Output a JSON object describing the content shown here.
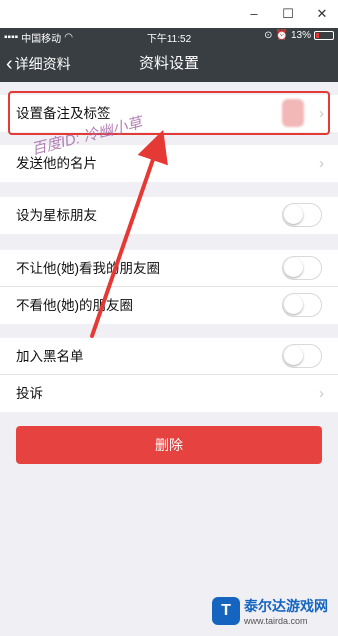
{
  "status_bar": {
    "carrier": "中国移动",
    "time": "下午11:52",
    "battery": "13%"
  },
  "window_controls": {
    "minimize": "–",
    "maximize": "☐",
    "close": "✕"
  },
  "nav": {
    "back_label": "详细资料",
    "title": "资料设置"
  },
  "settings": {
    "remark_label": "设置备注及标签",
    "send_card_label": "发送他的名片",
    "star_label": "设为星标朋友",
    "hide_from_label": "不让他(她)看我的朋友圈",
    "dont_view_label": "不看他(她)的朋友圈",
    "blacklist_label": "加入黑名单",
    "report_label": "投诉"
  },
  "toggles": {
    "star": false,
    "hide_from": false,
    "dont_view": false,
    "blacklist": false
  },
  "actions": {
    "delete_label": "删除"
  },
  "watermark": {
    "text": "百度ID: 冷幽小草"
  },
  "logo": {
    "name": "泰尔达游戏网",
    "url": "www.tairda.com"
  },
  "colors": {
    "nav_bg": "#383e42",
    "delete_bg": "#e64340",
    "highlight": "#e53935",
    "page_bg": "#efeff4"
  }
}
